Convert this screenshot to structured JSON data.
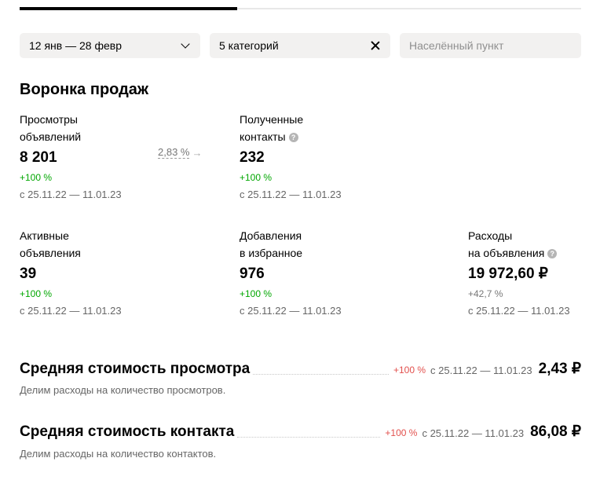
{
  "filters": {
    "date_range": "12 янв — 28 февр",
    "categories": "5 категорий",
    "city_placeholder": "Населённый пункт",
    "city_value": ""
  },
  "funnel": {
    "title": "Воронка продаж",
    "conversion": "2,83 %",
    "metrics": {
      "views": {
        "label_line1": "Просмотры",
        "label_line2": "объявлений",
        "value": "8 201",
        "delta": "+100 %",
        "period": "с 25.11.22 — 11.01.23"
      },
      "contacts": {
        "label_line1": "Полученные",
        "label_line2": "контакты",
        "value": "232",
        "delta": "+100 %",
        "period": "с 25.11.22 — 11.01.23"
      },
      "active": {
        "label_line1": "Активные",
        "label_line2": "объявления",
        "value": "39",
        "delta": "+100 %",
        "period": "с 25.11.22 — 11.01.23"
      },
      "favorites": {
        "label_line1": "Добавления",
        "label_line2": "в избранное",
        "value": "976",
        "delta": "+100 %",
        "period": "с 25.11.22 — 11.01.23"
      },
      "expenses": {
        "label_line1": "Расходы",
        "label_line2": "на объявления",
        "value": "19 972,60 ₽",
        "delta": "+42,7 %",
        "period": "с 25.11.22 — 11.01.23"
      }
    }
  },
  "costs": {
    "view": {
      "title": "Средняя стоимость просмотра",
      "delta": "+100 %",
      "period": "с 25.11.22 — 11.01.23",
      "amount": "2,43 ₽",
      "description": "Делим расходы на количество просмотров."
    },
    "contact": {
      "title": "Средняя стоимость контакта",
      "delta": "+100 %",
      "period": "с 25.11.22 — 11.01.23",
      "amount": "86,08 ₽",
      "description": "Делим расходы на количество контактов."
    }
  },
  "icons": {
    "date_dropdown": "chevron-down-icon",
    "category_clear": "close-icon",
    "help": "question-circle-icon",
    "conversion_arrow": "arrow-right-icon"
  },
  "colors": {
    "positive": "#02a702",
    "negative": "#e2504d",
    "filter_bg": "#f2f1f0"
  }
}
